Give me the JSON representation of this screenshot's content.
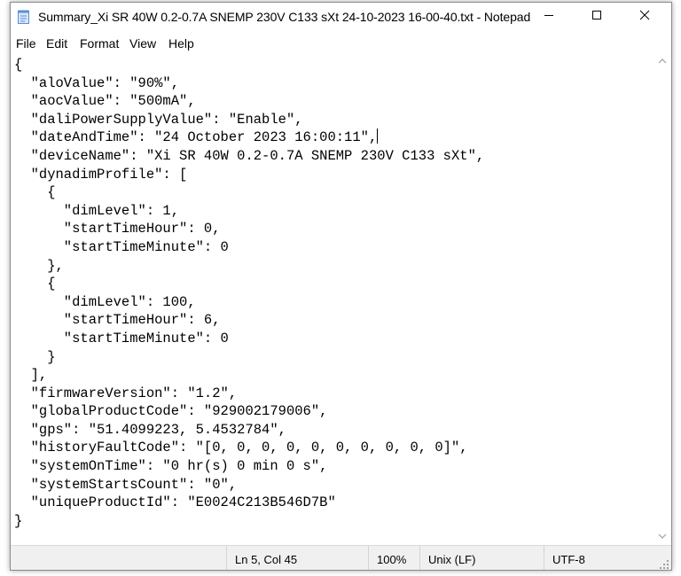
{
  "window": {
    "title": "Summary_Xi SR 40W 0.2-0.7A SNEMP 230V C133 sXt 24-10-2023 16-00-40.txt - Notepad",
    "app_icon": "notepad-icon",
    "controls": {
      "minimize_icon": "minimize-icon",
      "maximize_icon": "maximize-icon",
      "close_icon": "close-icon"
    }
  },
  "menu": {
    "items": [
      {
        "label": "File"
      },
      {
        "label": "Edit"
      },
      {
        "label": "Format"
      },
      {
        "label": "View"
      },
      {
        "label": "Help"
      }
    ]
  },
  "editor": {
    "lines": [
      "{",
      "  \"aloValue\": \"90%\",",
      "  \"aocValue\": \"500mA\",",
      "  \"daliPowerSupplyValue\": \"Enable\",",
      "  \"dateAndTime\": \"24 October 2023 16:00:11\",",
      "  \"deviceName\": \"Xi SR 40W 0.2-0.7A SNEMP 230V C133 sXt\",",
      "  \"dynadimProfile\": [",
      "    {",
      "      \"dimLevel\": 1,",
      "      \"startTimeHour\": 0,",
      "      \"startTimeMinute\": 0",
      "    },",
      "    {",
      "      \"dimLevel\": 100,",
      "      \"startTimeHour\": 6,",
      "      \"startTimeMinute\": 0",
      "    }",
      "  ],",
      "  \"firmwareVersion\": \"1.2\",",
      "  \"globalProductCode\": \"929002179006\",",
      "  \"gps\": \"51.4099223, 5.4532784\",",
      "  \"historyFaultCode\": \"[0, 0, 0, 0, 0, 0, 0, 0, 0, 0]\",",
      "  \"systemOnTime\": \"0 hr(s) 0 min 0 s\",",
      "  \"systemStartsCount\": \"0\",",
      "  \"uniqueProductId\": \"E0024C213B546D7B\"",
      "}"
    ],
    "caret_line": 5
  },
  "scrollbar": {
    "up_icon": "scroll-up-arrow-icon",
    "down_icon": "scroll-down-arrow-icon"
  },
  "status": {
    "position": "Ln 5, Col 45",
    "zoom": "100%",
    "line_ending": "Unix (LF)",
    "encoding": "UTF-8"
  },
  "colors": {
    "window_bg": "#ffffff",
    "status_bg": "#f0f0f0",
    "text": "#000000",
    "icon_blue": "#5b8fd6"
  }
}
